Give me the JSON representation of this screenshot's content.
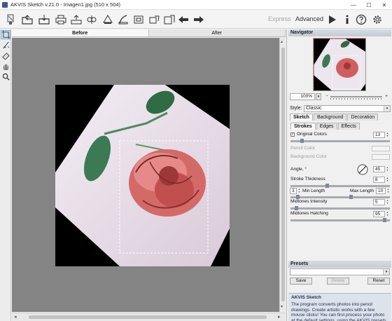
{
  "window": {
    "title": "AKVIS Sketch v.21.0 - Imagen1.jpg (510 x 504)",
    "controls": [
      "—",
      "☐",
      "✕"
    ]
  },
  "toolbar": {
    "modes": {
      "express": "Express",
      "advanced": "Advanced"
    }
  },
  "canvas": {
    "tabs": {
      "before": "Before",
      "after": "After"
    }
  },
  "panel": {
    "navigator": {
      "title": "Navigator",
      "zoom_value": "100%",
      "zoom_minus": "−",
      "zoom_plus": "+"
    },
    "style": {
      "label": "Style:",
      "value": "Classic"
    },
    "tabs_main": [
      "Sketch",
      "Background",
      "Decoration"
    ],
    "tabs_sub": [
      "Strokes",
      "Edges",
      "Effects"
    ],
    "original_colors": {
      "label": "Original Colors",
      "checked": true,
      "value": "13"
    },
    "pencil_color": "Pencil Color",
    "background_color": "Background Color",
    "angle": {
      "label": "Angle, °",
      "value": "45"
    },
    "stroke_thickness": {
      "label": "Stroke Thickness",
      "value": "8"
    },
    "min_length": {
      "label": "Min Length",
      "value": "3"
    },
    "max_length": {
      "label": "Max Length",
      "value": "10"
    },
    "midtones_intensity": {
      "label": "Midtones Intensity",
      "value": "5"
    },
    "midtones_hatching": {
      "label": "Midtones Hatching",
      "value": "95"
    },
    "presets": {
      "title": "Presets",
      "save": "Save",
      "delete": "Delete",
      "reset": "Reset"
    },
    "help": {
      "title": "AKVIS Sketch",
      "body": "The program converts photos into pencil drawings. Create artistic works with a few mouse clicks! You can first process your photo at the default settings, using the AKVIS presets, then adjust..."
    }
  }
}
